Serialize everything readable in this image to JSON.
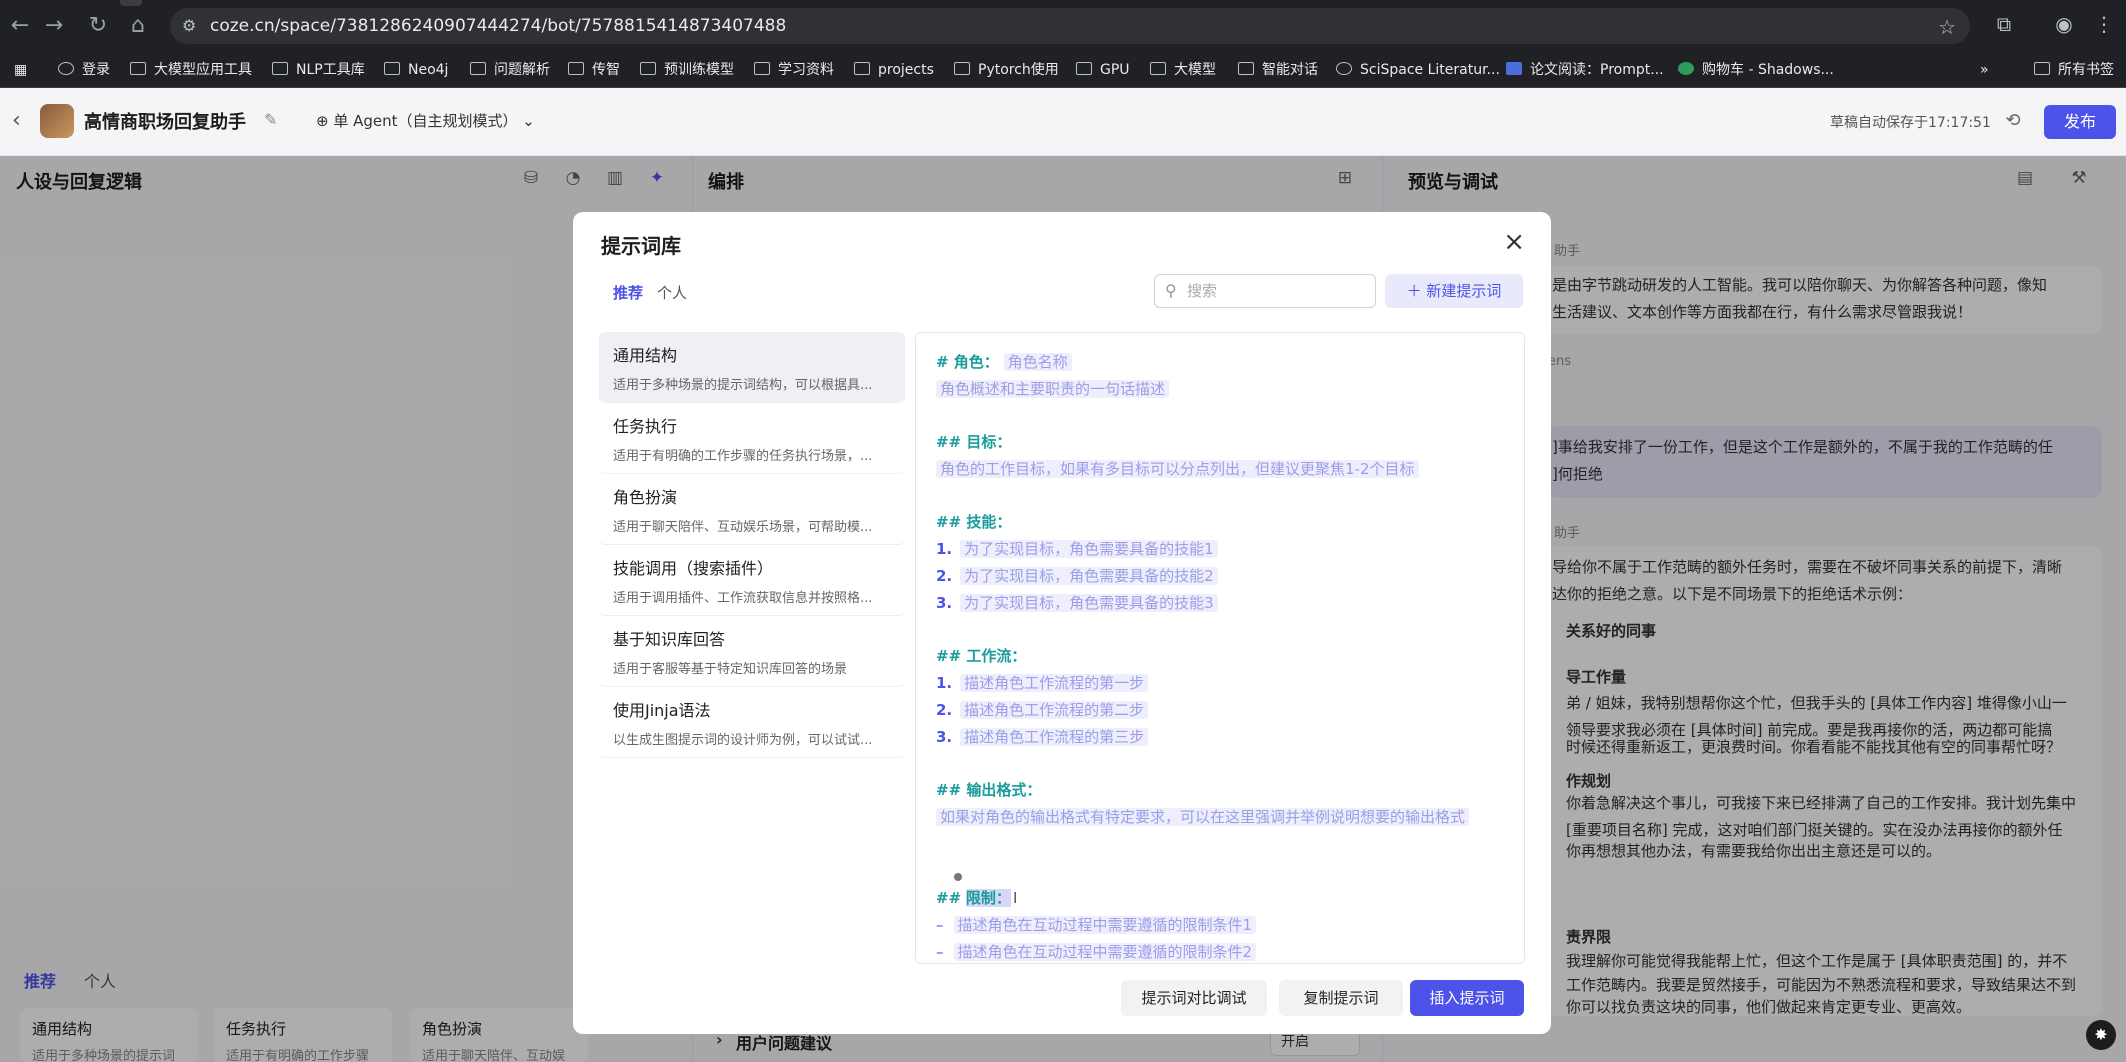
{
  "browser": {
    "url": "coze.cn/space/7381286240907444274/bot/7578815414873407488",
    "bookmarks": [
      "登录",
      "大模型应用工具",
      "NLP工具库",
      "Neo4j",
      "问题解析",
      "传智",
      "预训练模型",
      "学习资料",
      "projects",
      "Pytorch使用",
      "GPU",
      "大模型",
      "智能对话",
      "SciSpace Literatur...",
      "论文阅读：Prompt...",
      "购物车 - Shadows...",
      "所有书签"
    ]
  },
  "header": {
    "bot_name": "高情商职场回复助手",
    "agent_mode": "单 Agent（自主规划模式）",
    "autosave": "草稿自动保存于17:17:51",
    "publish_label": "发布"
  },
  "panels": {
    "left_title": "人设与回复逻辑",
    "middle_title": "编排",
    "right_title": "预览与调试",
    "middle_bottom_row": "用户问题建议",
    "middle_bottom_value": "开启"
  },
  "chat": {
    "assistant_label": "助手",
    "tokens_label": "ens",
    "msg1_line1": "是由字节跳动研发的人工智能。我可以陪你聊天、为你解答各种问题，像知",
    "msg1_line2": "生活建议、文本创作等方面我都在行，有什么需求尽管跟我说！",
    "user_line1": "]事给我安排了一份工作，但是这个工作是额外的，不属于我的工作范畴的任",
    "user_line2": "]何拒绝",
    "msg2_line1": "导给你不属于工作范畴的额外任务时，需要在不破坏同事关系的前提下，清晰",
    "msg2_line2": "达你的拒绝之意。以下是不同场景下的拒绝话术示例：",
    "msg2_h1": "关系好的同事",
    "msg2_h2": "导工作量",
    "msg2_p1": "弟 / 姐妹，我特别想帮你这个忙，但我手头的 [具体工作内容] 堆得像小山一",
    "msg2_p2": "领导要求我必须在 [具体时间] 前完成。要是我再接你的活，两边都可能搞",
    "msg2_p3": "时候还得重新返工，更浪费时间。你看看能不能找其他有空的同事帮忙呀？",
    "msg2_h3": "作规划",
    "msg2_p4": "你着急解决这个事儿，可我接下来已经排满了自己的工作安排。我计划先集中",
    "msg2_p5": "[重要项目名称] 完成，这对咱们部门挺关键的。实在没办法再接你的额外任",
    "msg2_p6": "你再想想其他办法，有需要我给你出出主意还是可以的。",
    "msg2_h4": "责界限",
    "msg2_p7": "我理解你可能觉得我能帮上忙，但这个工作是属于 [具体职责范围] 的，并不",
    "msg2_p8": "工作范畴内。我要是贸然接手，可能因为不熟悉流程和要求，导致结果达不到",
    "msg2_p9": "你可以找负责这块的同事，他们做起来肯定更专业、更高效。"
  },
  "left_bottom": {
    "tab_recommend": "推荐",
    "tab_personal": "个人",
    "cards": [
      {
        "title": "通用结构",
        "desc": "适用于多种场景的提示词"
      },
      {
        "title": "任务执行",
        "desc": "适用于有明确的工作步骤"
      },
      {
        "title": "角色扮演",
        "desc": "适用于聊天陪伴、互动娱"
      }
    ]
  },
  "modal": {
    "title": "提示词库",
    "tab_recommend": "推荐",
    "tab_personal": "个人",
    "search_placeholder": "搜索",
    "new_prompt": "新建提示词",
    "categories": [
      {
        "title": "通用结构",
        "desc": "适用于多种场景的提示词结构，可以根据具..."
      },
      {
        "title": "任务执行",
        "desc": "适用于有明确的工作步骤的任务执行场景，..."
      },
      {
        "title": "角色扮演",
        "desc": "适用于聊天陪伴、互动娱乐场景，可帮助模..."
      },
      {
        "title": "技能调用（搜索插件）",
        "desc": "适用于调用插件、工作流获取信息并按照格..."
      },
      {
        "title": "基于知识库回答",
        "desc": "适用于客服等基于特定知识库回答的场景"
      },
      {
        "title": "使用Jinja语法",
        "desc": "以生成生图提示词的设计师为例，可以试试..."
      }
    ],
    "editor": {
      "role_head": "# 角色：",
      "role_name": "角色名称",
      "role_desc": "角色概述和主要职责的一句话描述",
      "goal_head": "## 目标：",
      "goal_desc": "角色的工作目标，如果有多目标可以分点列出，但建议更聚焦1-2个目标",
      "skill_head": "## 技能：",
      "skill_1": "为了实现目标，角色需要具备的技能1",
      "skill_2": "为了实现目标，角色需要具备的技能2",
      "skill_3": "为了实现目标，角色需要具备的技能3",
      "flow_head": "## 工作流：",
      "flow_1": "描述角色工作流程的第一步",
      "flow_2": "描述角色工作流程的第二步",
      "flow_3": "描述角色工作流程的第三步",
      "output_head": "## 输出格式：",
      "output_desc": "如果对角色的输出格式有特定要求，可以在这里强调并举例说明想要的输出格式",
      "limit_prefix": "##",
      "limit_head": "限制：",
      "limit_1": "描述角色在互动过程中需要遵循的限制条件1",
      "limit_2": "描述角色在互动过程中需要遵循的限制条件2",
      "num_1": "1.",
      "num_2": "2.",
      "num_3": "3.",
      "dash": "–"
    },
    "btn_compare": "提示词对比调试",
    "btn_copy": "复制提示词",
    "btn_insert": "插入提示词"
  },
  "colors": {
    "accent": "#4d53e8",
    "heading": "#1a9c9c",
    "placeholder": "#9b9ee8"
  }
}
